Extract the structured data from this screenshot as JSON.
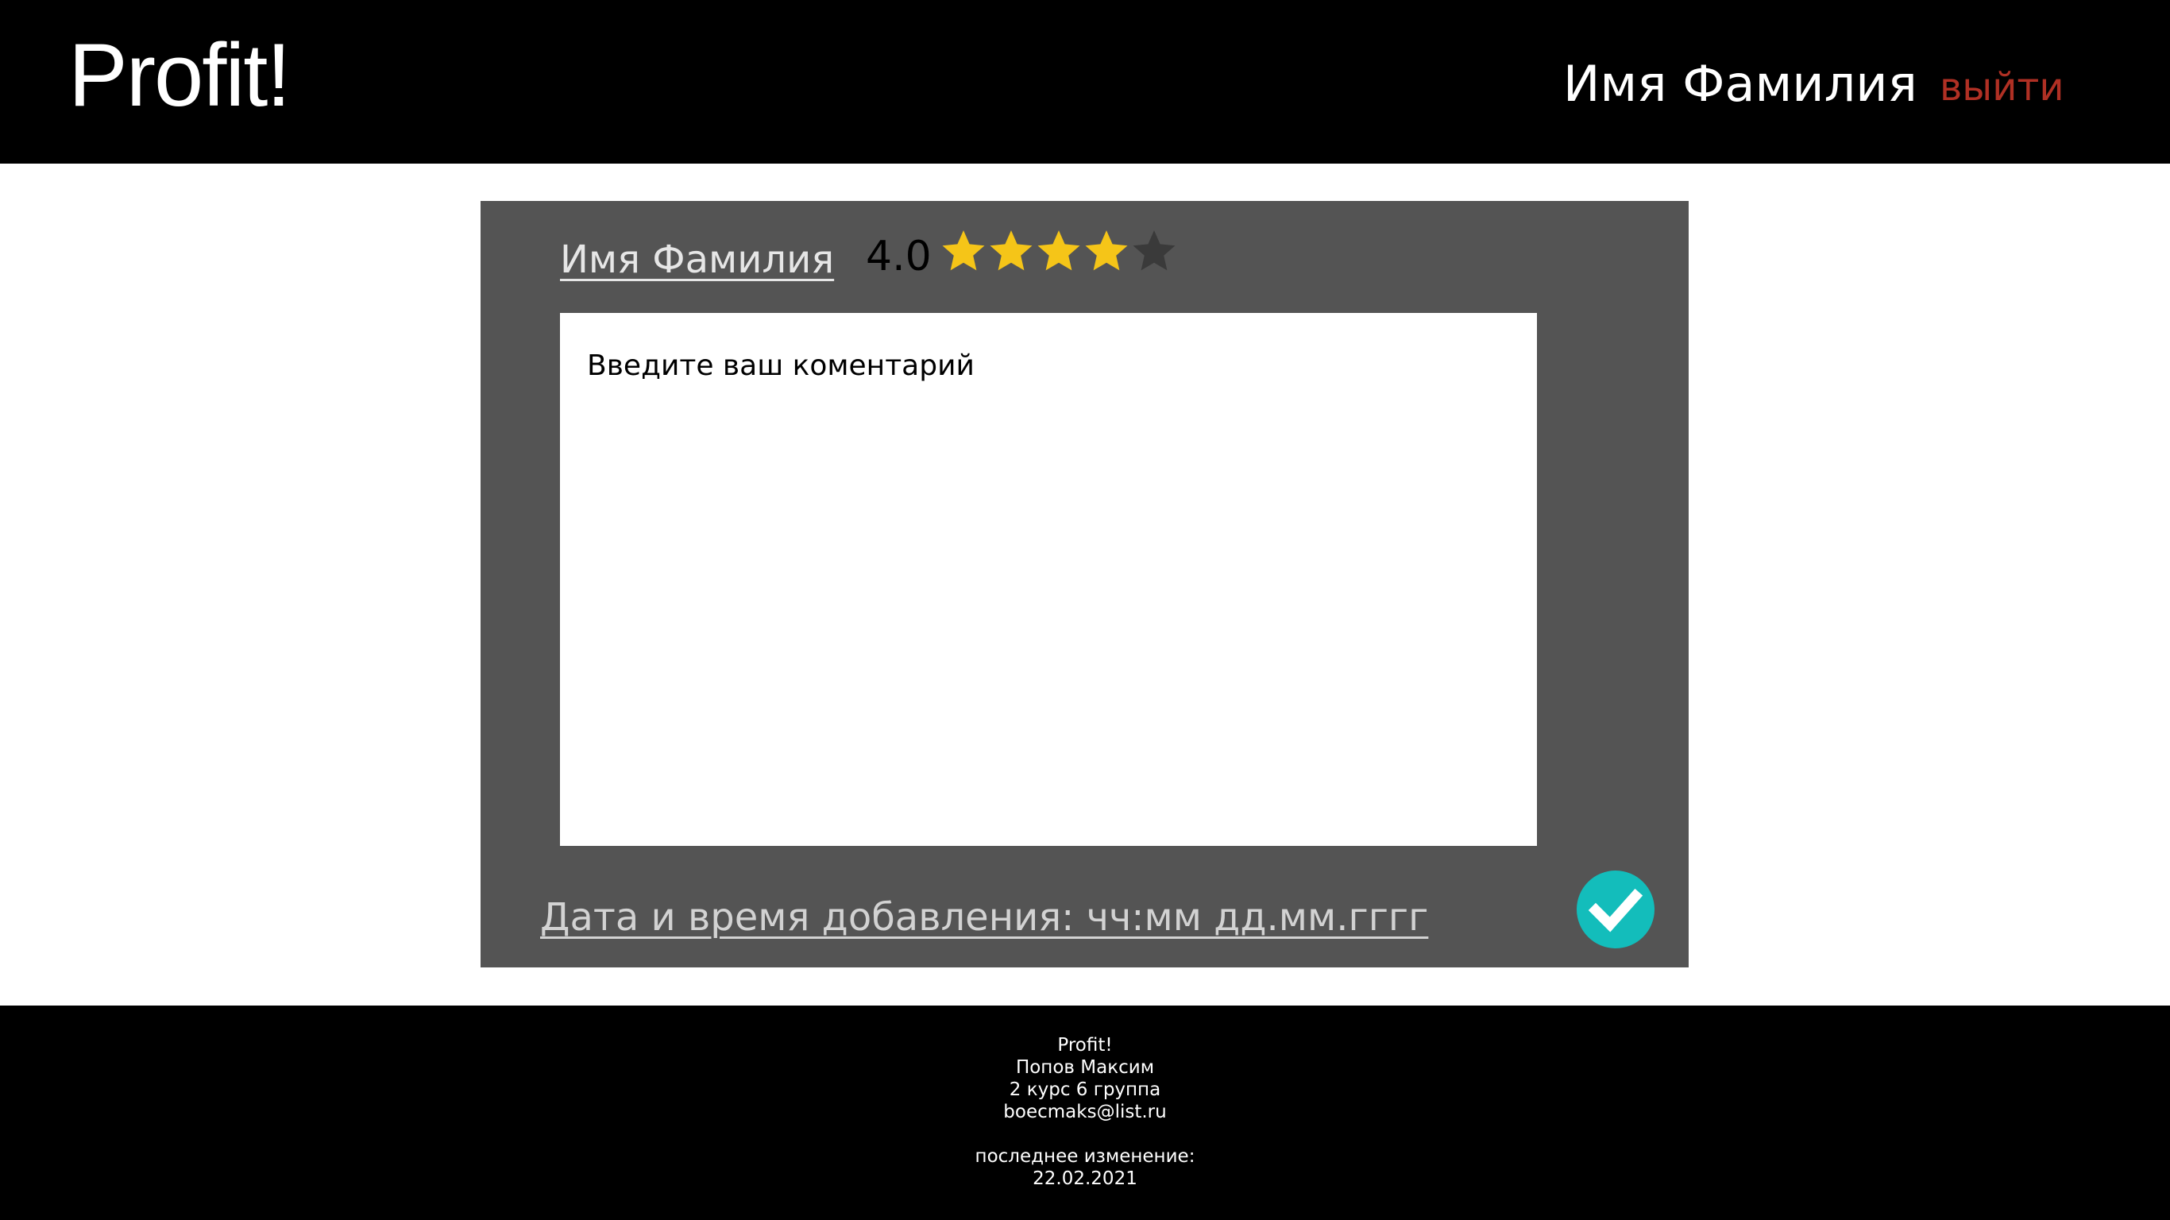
{
  "header": {
    "logo": "Profit!",
    "user_name": "Имя Фамилия",
    "logout_label": "выйти",
    "logout_color": "#b03024"
  },
  "review": {
    "author_name": "Имя Фамилия",
    "rating_text": "4.0",
    "rating_value": 4,
    "rating_max": 5,
    "star_filled_color": "#f5c518",
    "star_empty_color": "#3a3a3a",
    "comment_placeholder": "Введите ваш коментарий",
    "date_added_text": "Дата и время добавления: чч:мм дд.мм.гггг",
    "submit_icon": "checkmark-icon",
    "submit_color": "#13bdbb"
  },
  "footer": {
    "site_name": "Profit!",
    "author": "Попов Максим",
    "course": "2 курс 6 группа",
    "email": "boecmaks@list.ru",
    "last_modified_label": "последнее изменение:",
    "last_modified_date": "22.02.2021"
  }
}
